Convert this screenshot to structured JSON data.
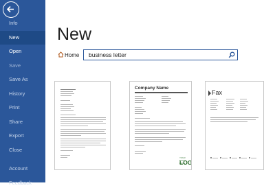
{
  "sidebar": {
    "items": [
      {
        "label": "Info"
      },
      {
        "label": "New"
      },
      {
        "label": "Open"
      },
      {
        "label": "Save"
      },
      {
        "label": "Save As"
      },
      {
        "label": "History"
      },
      {
        "label": "Print"
      },
      {
        "label": "Share"
      },
      {
        "label": "Export"
      },
      {
        "label": "Close"
      }
    ],
    "bottom_items": [
      {
        "label": "Account"
      },
      {
        "label": "Feedback"
      }
    ]
  },
  "main": {
    "title": "New",
    "home_label": "Home",
    "search": {
      "value": "business letter"
    }
  },
  "templates": [
    {
      "kind": "letter"
    },
    {
      "kind": "company-letter",
      "company_name": "Company Name",
      "logo_text": "LOGO",
      "logo_caption": "YOUR LOGO HERE"
    },
    {
      "kind": "fax",
      "title": "Fax"
    }
  ],
  "colors": {
    "accent": "#2b579a",
    "selected": "#1e4a86"
  }
}
